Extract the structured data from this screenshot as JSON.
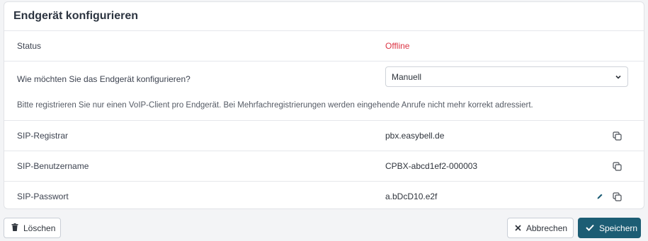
{
  "card": {
    "title": "Endgerät konfigurieren"
  },
  "status": {
    "label": "Status",
    "value": "Offline",
    "value_color": "#dc3545"
  },
  "config": {
    "question": "Wie möchten Sie das Endgerät konfigurieren?",
    "selected_option": "Manuell",
    "hint": "Bitte registrieren Sie nur einen VoIP-Client pro Endgerät. Bei Mehrfachregistrierungen werden eingehende Anrufe nicht mehr korrekt adressiert."
  },
  "sip": {
    "registrar": {
      "label": "SIP-Registrar",
      "value": "pbx.easybell.de"
    },
    "username": {
      "label": "SIP-Benutzername",
      "value": "CPBX-abcd1ef2-000003"
    },
    "password": {
      "label": "SIP-Passwort",
      "value": "a.bDcD10.e2f"
    }
  },
  "actions": {
    "delete_label": "Löschen",
    "cancel_label": "Abbrechen",
    "save_label": "Speichern"
  },
  "colors": {
    "primary": "#1c5d74",
    "danger": "#dc3545"
  },
  "icons": [
    "chevron-down-icon",
    "copy-icon",
    "pencil-icon",
    "trash-icon",
    "close-icon",
    "check-icon"
  ]
}
